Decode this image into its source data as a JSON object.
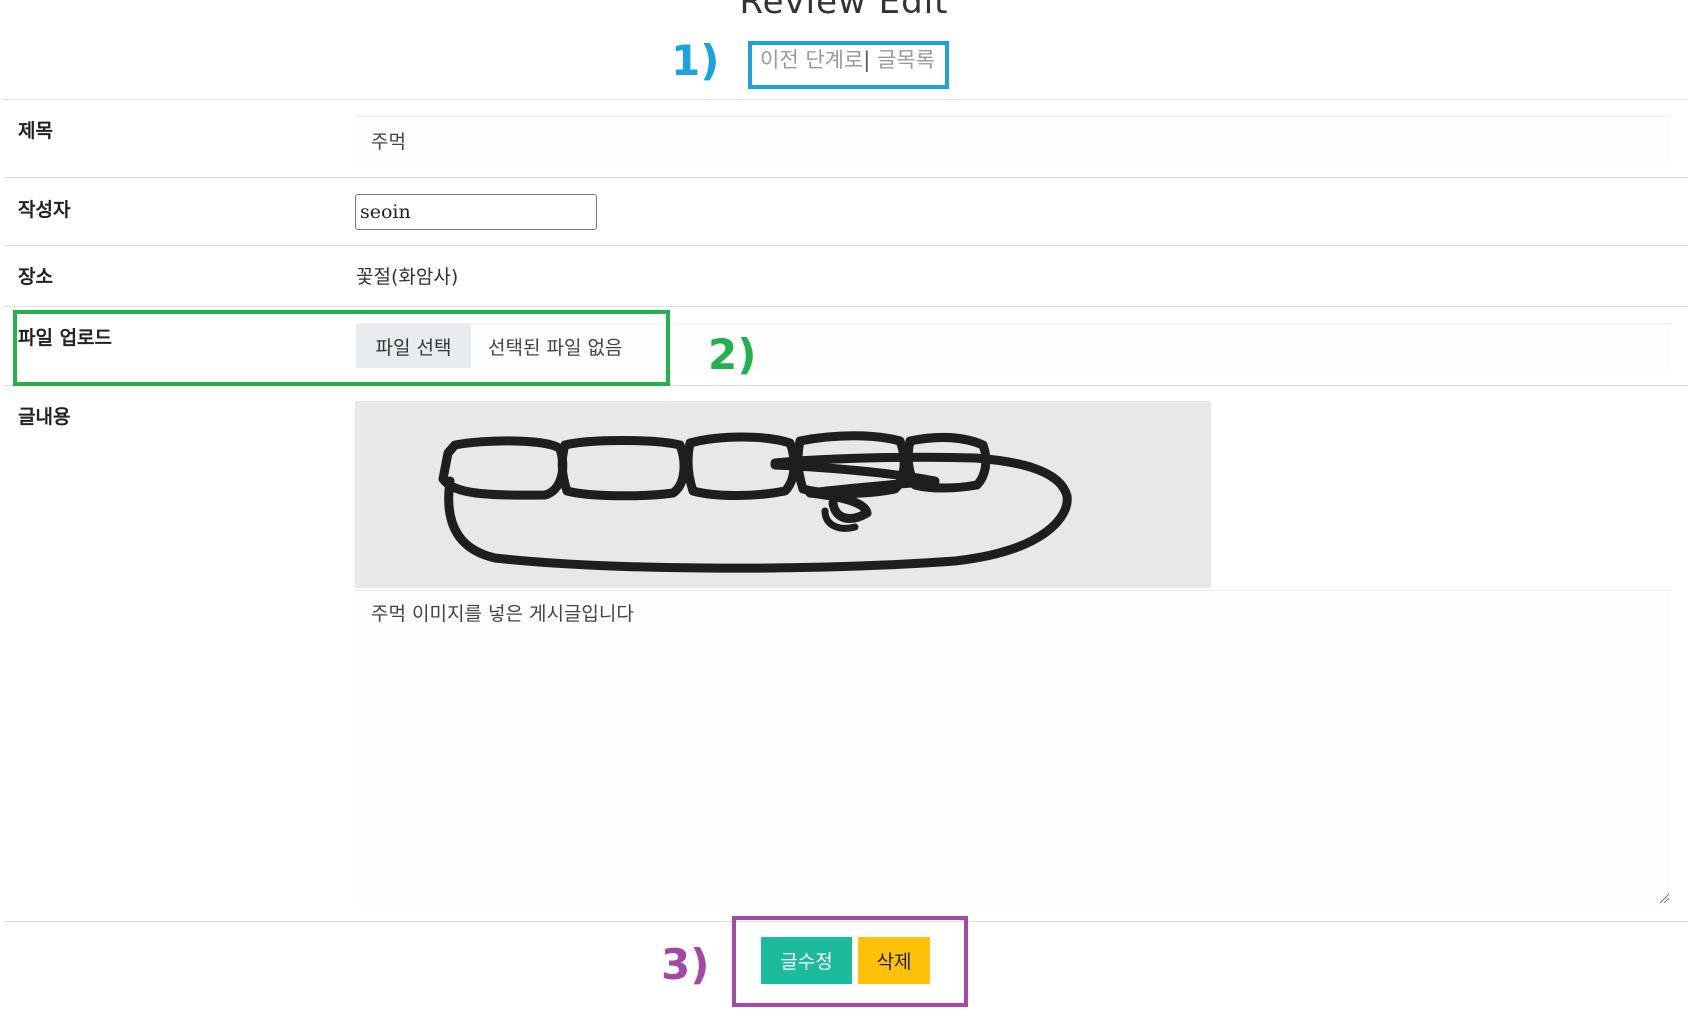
{
  "page": {
    "title": "Review Edit"
  },
  "nav": {
    "back_label": "이전 단계로",
    "separator": "|",
    "list_label": "글목록"
  },
  "form": {
    "title_label": "제목",
    "title_value": "주먹",
    "writer_label": "작성자",
    "writer_value": "seoin",
    "place_label": "장소",
    "place_value": "꽃절(화암사)",
    "file_label": "파일 업로드",
    "file_button_label": "파일 선택",
    "file_status": "선택된 파일 없음",
    "content_label": "글내용",
    "content_image_icon": "fist-image",
    "content_value": "주먹 이미지를 넣은 게시글입니다"
  },
  "actions": {
    "edit_label": "글수정",
    "delete_label": "삭제"
  },
  "annotations": [
    {
      "label": "1)",
      "color": "#1aa3e0"
    },
    {
      "label": "2)",
      "color": "#22b14c"
    },
    {
      "label": "3)",
      "color": "#a349a4"
    }
  ],
  "colors": {
    "edit_button": "#1abc9c",
    "delete_button": "#ffc107",
    "nav_link": "#9a9a9a"
  }
}
